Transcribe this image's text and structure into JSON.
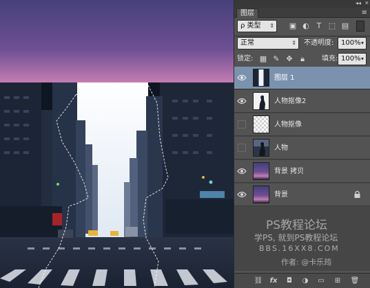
{
  "panel": {
    "topbar": {
      "arrows": "◂◂",
      "close": "✕"
    },
    "tab_label": "图层",
    "menu_icon": "≡",
    "filter": {
      "label": "ρ 类型",
      "icons": [
        "image-filter-icon",
        "adjustment-filter-icon",
        "type-filter-icon",
        "shape-filter-icon",
        "smart-object-filter-icon"
      ]
    },
    "blend_mode": "正常",
    "opacity_label": "不透明度:",
    "opacity_value": "100%",
    "lock_label": "锁定:",
    "fill_label": "填充:",
    "fill_value": "100%",
    "layers": [
      {
        "name": "图层 1",
        "visible": true,
        "selected": true,
        "locked": false,
        "thumb": "street-cutout-thumbnail"
      },
      {
        "name": "人物抠像2",
        "visible": true,
        "selected": false,
        "locked": false,
        "thumb": "person-silhouette-thumbnail"
      },
      {
        "name": "人物抠像",
        "visible": false,
        "selected": false,
        "locked": false,
        "thumb": "transparent-thumbnail"
      },
      {
        "name": "人物",
        "visible": false,
        "selected": false,
        "locked": false,
        "thumb": "person-photo-thumbnail"
      },
      {
        "name": "背景 拷贝",
        "visible": true,
        "selected": false,
        "locked": false,
        "thumb": "sky-thumbnail"
      },
      {
        "name": "背景",
        "visible": true,
        "selected": false,
        "locked": true,
        "thumb": "sky-thumbnail"
      }
    ],
    "bottom_icons": [
      "link-icon",
      "fx-icon",
      "mask-icon",
      "adjustment-icon",
      "group-icon",
      "new-layer-icon",
      "trash-icon"
    ]
  },
  "watermark": {
    "line1": "PS教程论坛",
    "line2": "学PS, 就到PS教程论坛",
    "line3": "BBS.16XX8.COM",
    "line4": "作者: @卡乐筠"
  },
  "colors": {
    "panel_bg": "#535353",
    "selected_layer": "#7b92ae",
    "sky_top": "#4a3d7a",
    "sky_bottom": "#c87ab0"
  }
}
